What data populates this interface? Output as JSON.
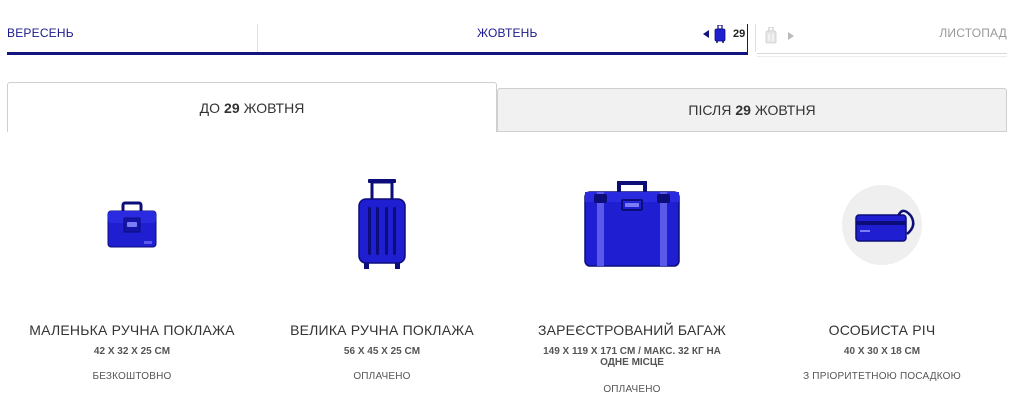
{
  "timeline": {
    "months": {
      "previous": "ВЕРЕСЕНЬ",
      "current": "ЖОВТЕНЬ",
      "next": "ЛИСТОПАД"
    },
    "selected_day": "29"
  },
  "tabs": [
    {
      "prefix": "ДО",
      "day": "29",
      "suffix": "ЖОВТНЯ"
    },
    {
      "prefix": "ПІСЛЯ",
      "day": "29",
      "suffix": "ЖОВТНЯ"
    }
  ],
  "items": [
    {
      "title": "МАЛЕНЬКА РУЧНА ПОКЛАЖА",
      "dims": "42 X 32 X 25 CM",
      "price": "БЕЗКОШТОВНО",
      "icon": "small-bag-icon"
    },
    {
      "title": "ВЕЛИКА РУЧНА ПОКЛАЖА",
      "dims": "56 X 45 X 25 CM",
      "price": "ОПЛАЧЕНО",
      "icon": "trolley-suitcase-icon"
    },
    {
      "title": "ЗАРЕЄСТРОВАНИЙ БАГАЖ",
      "dims": "149 X 119 X 171 CM / МАКС. 32 КГ НА ОДНЕ МІСЦЕ",
      "price": "ОПЛАЧЕНО",
      "icon": "checked-suitcase-icon"
    },
    {
      "title": "ОСОБИСТА РІЧ",
      "dims": "40 X 30 X 18 CM",
      "price": "З ПРІОРИТЕТНОЮ ПОСАДКОЮ",
      "icon": "personal-item-icon"
    }
  ],
  "colors": {
    "brand": "#141480",
    "icon_blue": "#1f1fd1",
    "icon_dark": "#0d0d7a"
  }
}
